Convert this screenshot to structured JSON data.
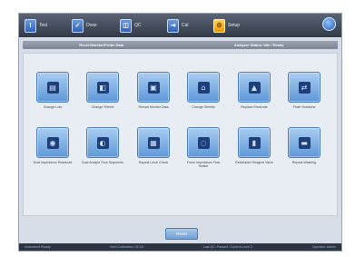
{
  "topbar": {
    "modes": [
      {
        "label": "Test",
        "glyph": "I",
        "icon": "test-icon"
      },
      {
        "label": "Dose",
        "glyph": "✓",
        "icon": "dose-icon"
      },
      {
        "label": "QC",
        "glyph": "◫",
        "icon": "qc-icon"
      },
      {
        "label": "Cal",
        "glyph": "⇥",
        "icon": "cal-icon"
      },
      {
        "label": "Setup",
        "glyph": "⚙",
        "icon": "setup-icon"
      }
    ]
  },
  "panel_header": {
    "left": "Reset Monitor/Probe Data",
    "right": "Analyzer Status: Idle / Ready"
  },
  "tiles": [
    {
      "label": "Change Lots",
      "glyph": "▤",
      "icon": "change-lots-icon"
    },
    {
      "label": "Change Sheets",
      "glyph": "◧",
      "icon": "change-sheets-icon"
    },
    {
      "label": "Reload Monitor Data",
      "glyph": "▣",
      "icon": "reload-monitor-icon"
    },
    {
      "label": "Change Shields",
      "glyph": "⌂",
      "icon": "change-shields-icon"
    },
    {
      "label": "Replace Electrode",
      "glyph": "▲",
      "icon": "replace-electrode-icon"
    },
    {
      "label": "Flush Solutions",
      "glyph": "⇄",
      "icon": "flush-solutions-icon"
    },
    {
      "label": "Dual Impedance Readouts",
      "glyph": "◉",
      "icon": "dual-impedance-icon"
    },
    {
      "label": "Dual Analyte Flow Segments",
      "glyph": "◐",
      "icon": "dual-analyte-icon"
    },
    {
      "label": "Repeat Level Check",
      "glyph": "▦",
      "icon": "repeat-level-icon"
    },
    {
      "label": "Force Impedance Flow Switch",
      "glyph": "◌",
      "icon": "force-impedance-icon"
    },
    {
      "label": "Reinitialize Reagent Valve",
      "glyph": "▮",
      "icon": "reinitialize-icon"
    },
    {
      "label": "Repeat Washing",
      "glyph": "▬",
      "icon": "repeat-washing-icon"
    }
  ],
  "reset_label": "Reset",
  "statusbar": {
    "items": [
      "Instrument Ready",
      "Next Calibration: 02:15",
      "Last QC: Passed / Control Level 2",
      "Operator: Admin"
    ]
  }
}
